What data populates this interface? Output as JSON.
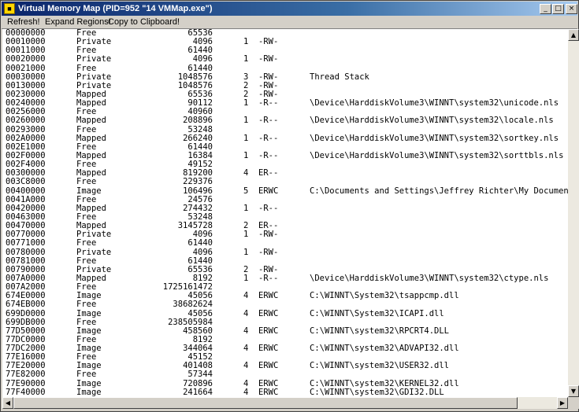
{
  "window": {
    "title": "Virtual Memory Map (PID=952 \"14 VMMap.exe\")",
    "minimize_glyph": "_",
    "maximize_glyph": "□",
    "close_glyph": "×"
  },
  "menu": [
    "Refresh!",
    "Expand Regions!",
    "Copy to Clipboard!"
  ],
  "scroll": {
    "up": "▲",
    "down": "▼",
    "left": "◀",
    "right": "▶"
  },
  "rows": [
    {
      "addr": "00000000",
      "type": "Free",
      "size": "65536",
      "blocks": "",
      "prot": "",
      "desc": ""
    },
    {
      "addr": "00010000",
      "type": "Private",
      "size": "4096",
      "blocks": "1",
      "prot": "-RW-",
      "desc": ""
    },
    {
      "addr": "00011000",
      "type": "Free",
      "size": "61440",
      "blocks": "",
      "prot": "",
      "desc": ""
    },
    {
      "addr": "00020000",
      "type": "Private",
      "size": "4096",
      "blocks": "1",
      "prot": "-RW-",
      "desc": ""
    },
    {
      "addr": "00021000",
      "type": "Free",
      "size": "61440",
      "blocks": "",
      "prot": "",
      "desc": ""
    },
    {
      "addr": "00030000",
      "type": "Private",
      "size": "1048576",
      "blocks": "3",
      "prot": "-RW-",
      "desc": "Thread Stack"
    },
    {
      "addr": "00130000",
      "type": "Private",
      "size": "1048576",
      "blocks": "2",
      "prot": "-RW-",
      "desc": ""
    },
    {
      "addr": "00230000",
      "type": "Mapped",
      "size": "65536",
      "blocks": "2",
      "prot": "-RW-",
      "desc": ""
    },
    {
      "addr": "00240000",
      "type": "Mapped",
      "size": "90112",
      "blocks": "1",
      "prot": "-R--",
      "desc": "\\Device\\HarddiskVolume3\\WINNT\\system32\\unicode.nls"
    },
    {
      "addr": "00256000",
      "type": "Free",
      "size": "40960",
      "blocks": "",
      "prot": "",
      "desc": ""
    },
    {
      "addr": "00260000",
      "type": "Mapped",
      "size": "208896",
      "blocks": "1",
      "prot": "-R--",
      "desc": "\\Device\\HarddiskVolume3\\WINNT\\system32\\locale.nls"
    },
    {
      "addr": "00293000",
      "type": "Free",
      "size": "53248",
      "blocks": "",
      "prot": "",
      "desc": ""
    },
    {
      "addr": "002A0000",
      "type": "Mapped",
      "size": "266240",
      "blocks": "1",
      "prot": "-R--",
      "desc": "\\Device\\HarddiskVolume3\\WINNT\\system32\\sortkey.nls"
    },
    {
      "addr": "002E1000",
      "type": "Free",
      "size": "61440",
      "blocks": "",
      "prot": "",
      "desc": ""
    },
    {
      "addr": "002F0000",
      "type": "Mapped",
      "size": "16384",
      "blocks": "1",
      "prot": "-R--",
      "desc": "\\Device\\HarddiskVolume3\\WINNT\\system32\\sorttbls.nls"
    },
    {
      "addr": "002F4000",
      "type": "Free",
      "size": "49152",
      "blocks": "",
      "prot": "",
      "desc": ""
    },
    {
      "addr": "00300000",
      "type": "Mapped",
      "size": "819200",
      "blocks": "4",
      "prot": "ER--",
      "desc": ""
    },
    {
      "addr": "003C8000",
      "type": "Free",
      "size": "229376",
      "blocks": "",
      "prot": "",
      "desc": ""
    },
    {
      "addr": "00400000",
      "type": "Image",
      "size": "106496",
      "blocks": "5",
      "prot": "ERWC",
      "desc": "C:\\Documents and Settings\\Jeffrey Richter\\My Documents"
    },
    {
      "addr": "0041A000",
      "type": "Free",
      "size": "24576",
      "blocks": "",
      "prot": "",
      "desc": ""
    },
    {
      "addr": "00420000",
      "type": "Mapped",
      "size": "274432",
      "blocks": "1",
      "prot": "-R--",
      "desc": ""
    },
    {
      "addr": "00463000",
      "type": "Free",
      "size": "53248",
      "blocks": "",
      "prot": "",
      "desc": ""
    },
    {
      "addr": "00470000",
      "type": "Mapped",
      "size": "3145728",
      "blocks": "2",
      "prot": "ER--",
      "desc": ""
    },
    {
      "addr": "00770000",
      "type": "Private",
      "size": "4096",
      "blocks": "1",
      "prot": "-RW-",
      "desc": ""
    },
    {
      "addr": "00771000",
      "type": "Free",
      "size": "61440",
      "blocks": "",
      "prot": "",
      "desc": ""
    },
    {
      "addr": "00780000",
      "type": "Private",
      "size": "4096",
      "blocks": "1",
      "prot": "-RW-",
      "desc": ""
    },
    {
      "addr": "00781000",
      "type": "Free",
      "size": "61440",
      "blocks": "",
      "prot": "",
      "desc": ""
    },
    {
      "addr": "00790000",
      "type": "Private",
      "size": "65536",
      "blocks": "2",
      "prot": "-RW-",
      "desc": ""
    },
    {
      "addr": "007A0000",
      "type": "Mapped",
      "size": "8192",
      "blocks": "1",
      "prot": "-R--",
      "desc": "\\Device\\HarddiskVolume3\\WINNT\\system32\\ctype.nls"
    },
    {
      "addr": "007A2000",
      "type": "Free",
      "size": "1725161472",
      "blocks": "",
      "prot": "",
      "desc": ""
    },
    {
      "addr": "674E0000",
      "type": "Image",
      "size": "45056",
      "blocks": "4",
      "prot": "ERWC",
      "desc": "C:\\WINNT\\System32\\tsappcmp.dll"
    },
    {
      "addr": "674EB000",
      "type": "Free",
      "size": "38682624",
      "blocks": "",
      "prot": "",
      "desc": ""
    },
    {
      "addr": "699D0000",
      "type": "Image",
      "size": "45056",
      "blocks": "4",
      "prot": "ERWC",
      "desc": "C:\\WINNT\\System32\\ICAPI.dll"
    },
    {
      "addr": "699DB000",
      "type": "Free",
      "size": "238505984",
      "blocks": "",
      "prot": "",
      "desc": ""
    },
    {
      "addr": "77D50000",
      "type": "Image",
      "size": "458560",
      "blocks": "4",
      "prot": "ERWC",
      "desc": "C:\\WINNT\\system32\\RPCRT4.DLL"
    },
    {
      "addr": "77DC0000",
      "type": "Free",
      "size": "8192",
      "blocks": "",
      "prot": "",
      "desc": ""
    },
    {
      "addr": "77DC2000",
      "type": "Image",
      "size": "344064",
      "blocks": "4",
      "prot": "ERWC",
      "desc": "C:\\WINNT\\system32\\ADVAPI32.dll"
    },
    {
      "addr": "77E16000",
      "type": "Free",
      "size": "45152",
      "blocks": "",
      "prot": "",
      "desc": ""
    },
    {
      "addr": "77E20000",
      "type": "Image",
      "size": "401408",
      "blocks": "4",
      "prot": "ERWC",
      "desc": "C:\\WINNT\\system32\\USER32.dll"
    },
    {
      "addr": "77E82000",
      "type": "Free",
      "size": "57344",
      "blocks": "",
      "prot": "",
      "desc": ""
    },
    {
      "addr": "77E90000",
      "type": "Image",
      "size": "720896",
      "blocks": "4",
      "prot": "ERWC",
      "desc": "C:\\WINNT\\system32\\KERNEL32.dll"
    },
    {
      "addr": "77F40000",
      "type": "Image",
      "size": "241664",
      "blocks": "4",
      "prot": "ERWC",
      "desc": "C:\\WINNT\\system32\\GDI32.DLL"
    }
  ]
}
